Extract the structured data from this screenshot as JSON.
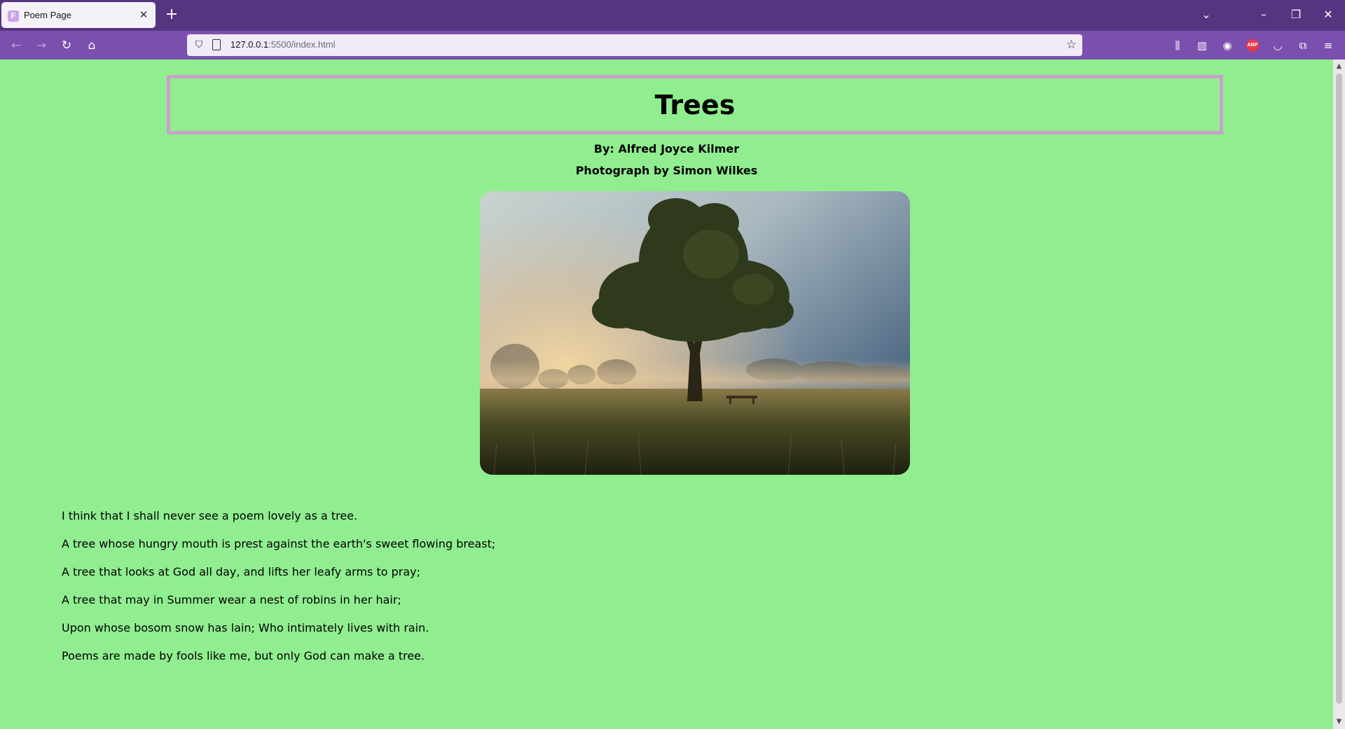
{
  "browser": {
    "tab_title": "Poem Page",
    "tab_favicon_letter": "F",
    "url_host": "127.0.0.1",
    "url_rest": ":5500/index.html",
    "abp_label": "ABP"
  },
  "page": {
    "title": "Trees",
    "author": "By: Alfred Joyce Kilmer",
    "photo_credit": "Photograph by Simon Wilkes",
    "poem_lines": [
      "I think that I shall never see a poem lovely as a tree.",
      "A tree whose hungry mouth is prest against the earth's sweet flowing breast;",
      "A tree that looks at God all day, and lifts her leafy arms to pray;",
      "A tree that may in Summer wear a nest of robins in her hair;",
      "Upon whose bosom snow has lain; Who intimately lives with rain.",
      "Poems are made by fools like me, but only God can make a tree."
    ]
  },
  "colors": {
    "page_background": "#90ee90",
    "title_border": "#c8a2c8",
    "tabbar": "#55357f",
    "toolbar": "#7a4fae"
  }
}
